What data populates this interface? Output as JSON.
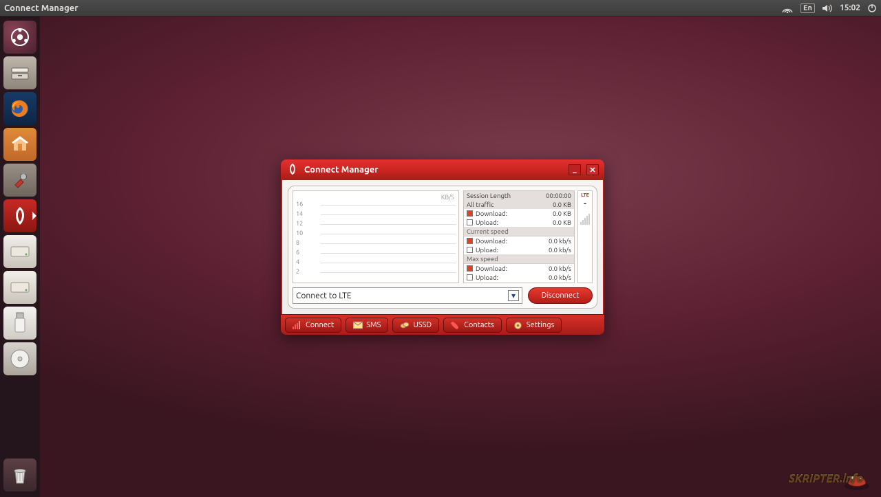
{
  "menubar": {
    "app_title": "Connect Manager",
    "lang": "En",
    "time": "15:02"
  },
  "launcher": {
    "items": [
      {
        "name": "dash-icon"
      },
      {
        "name": "files-icon"
      },
      {
        "name": "firefox-icon"
      },
      {
        "name": "software-center-icon"
      },
      {
        "name": "system-settings-icon"
      },
      {
        "name": "connect-manager-icon"
      },
      {
        "name": "disk-icon"
      },
      {
        "name": "disk-icon"
      },
      {
        "name": "usb-drive-icon"
      },
      {
        "name": "optical-disc-icon"
      }
    ]
  },
  "window": {
    "title": "Connect Manager",
    "chart": {
      "unit": "KB/S"
    },
    "stats": {
      "session_length_label": "Session Length",
      "session_length_value": "00:00:00",
      "all_traffic_label": "All traffic",
      "all_traffic_value": "0.0 KB",
      "download_label": "Download:",
      "upload_label": "Upload:",
      "traffic_download": "0.0 KB",
      "traffic_upload": "0.0 KB",
      "current_speed_label": "Current speed",
      "cur_download": "0.0 kb/s",
      "cur_upload": "0.0 kb/s",
      "max_speed_label": "Max speed",
      "max_download": "0.0 kb/s",
      "max_upload": "0.0 kb/s",
      "net_badge": "LTE"
    },
    "connection_select": "Connect to LTE",
    "disconnect_label": "Disconnect",
    "tabs": {
      "connect": "Connect",
      "sms": "SMS",
      "ussd": "USSD",
      "contacts": "Contacts",
      "settings": "Settings"
    }
  },
  "watermark": "SKRIPTER.info",
  "chart_data": {
    "type": "line",
    "title": "",
    "xlabel": "",
    "ylabel": "KB/S",
    "ylim": [
      0,
      16
    ],
    "y_ticks": [
      2.0,
      4.0,
      6.0,
      8.0,
      10.0,
      12.0,
      14.0,
      16.0
    ],
    "series": [
      {
        "name": "Download",
        "values": []
      },
      {
        "name": "Upload",
        "values": []
      }
    ]
  }
}
